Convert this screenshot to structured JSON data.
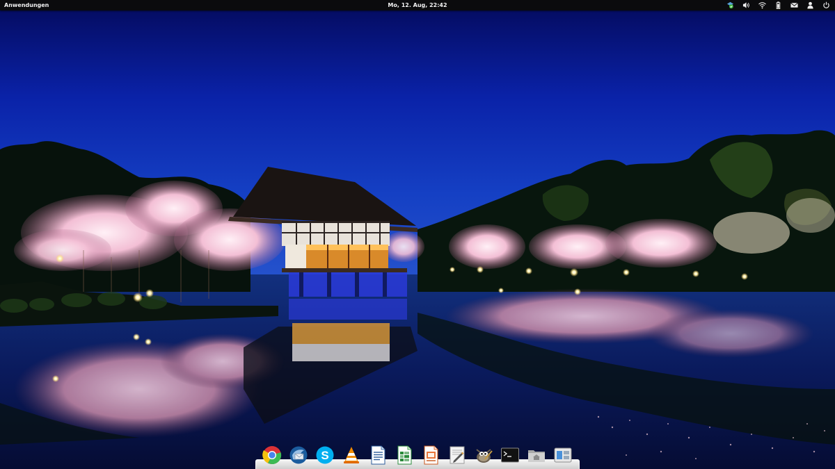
{
  "panel": {
    "applications_label": "Anwendungen",
    "clock": "Mo, 12. Aug, 22:42",
    "indicators": [
      "update-shield-icon",
      "volume-icon",
      "wifi-icon",
      "battery-icon",
      "mail-icon",
      "user-icon",
      "power-icon"
    ]
  },
  "dock": {
    "apps": [
      "chrome-icon",
      "thunderbird-icon",
      "skype-icon",
      "vlc-icon",
      "libreoffice-writer-icon",
      "libreoffice-calc-icon",
      "libreoffice-impress-icon",
      "text-editor-icon",
      "gimp-icon",
      "terminal-icon",
      "home-folder-icon",
      "multitasking-view-icon"
    ]
  },
  "colors": {
    "sky_top": "#050c66",
    "sky_mid": "#0d2fbf",
    "sky_horizon": "#1f49c8",
    "blossom": "#f2c2d8",
    "panel_bg": "#0b0b0d"
  }
}
